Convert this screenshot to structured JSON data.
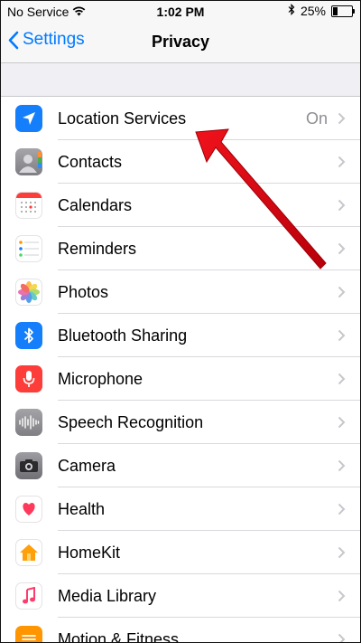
{
  "status_bar": {
    "carrier": "No Service",
    "time": "1:02 PM",
    "battery_percent": "25%",
    "battery_level": 0.25
  },
  "nav": {
    "back_label": "Settings",
    "title": "Privacy"
  },
  "rows": [
    {
      "label": "Location Services",
      "detail": "On",
      "icon": "location-arrow-icon",
      "color": "#147efb"
    },
    {
      "label": "Contacts",
      "icon": "contacts-icon",
      "color": "#8e8e93"
    },
    {
      "label": "Calendars",
      "icon": "calendar-icon",
      "color": "#ffffff"
    },
    {
      "label": "Reminders",
      "icon": "reminders-icon",
      "color": "#ffffff"
    },
    {
      "label": "Photos",
      "icon": "photos-icon",
      "color": "#ffffff"
    },
    {
      "label": "Bluetooth Sharing",
      "icon": "bluetooth-icon",
      "color": "#147efb"
    },
    {
      "label": "Microphone",
      "icon": "microphone-icon",
      "color": "#fc3d39"
    },
    {
      "label": "Speech Recognition",
      "icon": "waveform-icon",
      "color": "#8e8e93"
    },
    {
      "label": "Camera",
      "icon": "camera-icon",
      "color": "#8e8e93"
    },
    {
      "label": "Health",
      "icon": "heart-icon",
      "color": "#ffffff"
    },
    {
      "label": "HomeKit",
      "icon": "home-icon",
      "color": "#ffffff"
    },
    {
      "label": "Media Library",
      "icon": "music-note-icon",
      "color": "#ffffff"
    },
    {
      "label": "Motion & Fitness",
      "icon": "motion-icon",
      "color": "#ff9500"
    }
  ],
  "colors": {
    "accent": "#007aff",
    "annotation_arrow": "#e3000b"
  }
}
